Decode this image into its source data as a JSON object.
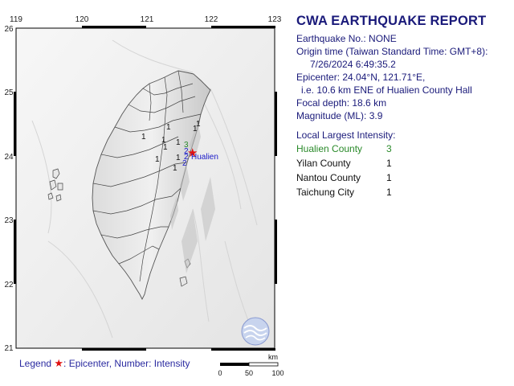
{
  "report": {
    "title": "CWA EARTHQUAKE REPORT",
    "lines": [
      "Earthquake No.: NONE",
      "Origin time (Taiwan Standard Time: GMT+8):",
      "7/26/2024  6:49:35.2",
      "Epicenter: 24.04°N, 121.71°E,",
      "i.e. 10.6 km ENE of Hualien County Hall",
      "Focal depth: 18.6 km",
      "Magnitude (ML): 3.9"
    ],
    "intensity_heading": "Local Largest Intensity:",
    "intensities": [
      {
        "county": "Hualien County",
        "value": "3",
        "color": "#2a8a2a"
      },
      {
        "county": "Yilan County",
        "value": "1",
        "color": "#111111"
      },
      {
        "county": "Nantou County",
        "value": "1",
        "color": "#111111"
      },
      {
        "county": "Taichung City",
        "value": "1",
        "color": "#111111"
      }
    ]
  },
  "map": {
    "x_ticks": [
      "119",
      "120",
      "121",
      "122",
      "123"
    ],
    "y_ticks": [
      "26",
      "25",
      "24",
      "23",
      "22",
      "21"
    ],
    "epicenter_label": "Hualien",
    "epicenter_symbol": "★",
    "epicenter_color": "#e01010",
    "station_intensities": [
      {
        "value": "3",
        "color": "#2a8a2a"
      },
      {
        "value": "2",
        "color": "#1a1ac8"
      },
      {
        "value": "2",
        "color": "#1a1ac8"
      },
      {
        "value": "2",
        "color": "#1a1ac8"
      },
      {
        "value": "1",
        "color": "#111111"
      },
      {
        "value": "1",
        "color": "#111111"
      },
      {
        "value": "1",
        "color": "#111111"
      },
      {
        "value": "1",
        "color": "#111111"
      },
      {
        "value": "1",
        "color": "#111111"
      },
      {
        "value": "1",
        "color": "#111111"
      },
      {
        "value": "1",
        "color": "#111111"
      },
      {
        "value": "1",
        "color": "#111111"
      },
      {
        "value": "1",
        "color": "#111111"
      },
      {
        "value": "1",
        "color": "#111111"
      }
    ],
    "scale_unit": "km",
    "scale_labels": [
      "0",
      "50",
      "100"
    ]
  },
  "legend": {
    "prefix": "Legend",
    "star": "★",
    "text": ": Epicenter, Number: Intensity"
  },
  "colors": {
    "title": "#1a1a7a",
    "grid": "#000000",
    "sea": "#ffffff",
    "land": "#f4f4f4"
  }
}
